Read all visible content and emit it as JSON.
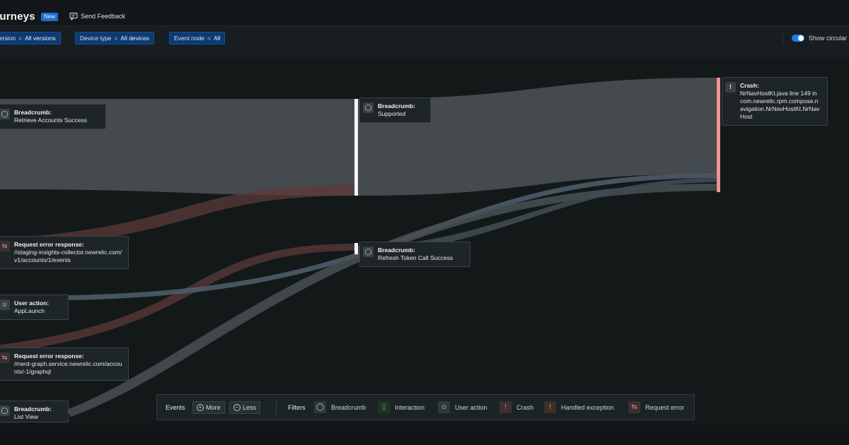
{
  "header": {
    "title": "ourneys",
    "badge": "New",
    "feedback_label": "Send Feedback"
  },
  "filters": [
    {
      "key": "ersion",
      "op": "=",
      "value": "All versions"
    },
    {
      "key": "Device type",
      "op": "=",
      "value": "All devices"
    },
    {
      "key": "Event node",
      "op": "=",
      "value": "All"
    }
  ],
  "toggle": {
    "label": "Show circular",
    "on": true
  },
  "nodes": {
    "n1": {
      "type": "Breadcrumb:",
      "label": "Retrieve Accounts Success",
      "icon": "breadcrumb-icon"
    },
    "n2": {
      "type": "Request error response:",
      "label": "//staging-insights-collector.newrelic.com/v1/accounts/1/events",
      "icon": "request-error-icon"
    },
    "n3": {
      "type": "User action:",
      "label": "AppLaunch",
      "icon": "user-action-icon"
    },
    "n4": {
      "type": "Request error response:",
      "label": "//nerd-graph.service.newrelic.com/accounts/-1/graphql",
      "icon": "request-error-icon"
    },
    "n5": {
      "type": "Breadcrumb:",
      "label": "List View",
      "icon": "breadcrumb-icon"
    },
    "n6": {
      "type": "Breadcrumb:",
      "label": "Supported",
      "icon": "breadcrumb-icon"
    },
    "n7": {
      "type": "Breadcrumb:",
      "label": "Refresh Token Call Success",
      "icon": "breadcrumb-icon"
    },
    "n8": {
      "type": "Crash:",
      "label": "NrNavHostKt.java line 149 in com.newrelic.rpm.compose.navigation.NrNavHostKt.NrNavHost",
      "icon": "crash-icon"
    }
  },
  "legend": {
    "events_label": "Events",
    "more_label": "More",
    "less_label": "Less",
    "filters_label": "Filters",
    "items": [
      {
        "label": "Breadcrumb",
        "icon": "breadcrumb-icon"
      },
      {
        "label": "Interaction",
        "icon": "interaction-icon"
      },
      {
        "label": "User action",
        "icon": "user-action-icon"
      },
      {
        "label": "Crash",
        "icon": "crash-icon"
      },
      {
        "label": "Handled exception",
        "icon": "handled-exception-icon"
      },
      {
        "label": "Request error",
        "icon": "request-error-icon"
      }
    ]
  },
  "colors": {
    "flow_gray": "#4a5053",
    "flow_red": "#6b3a38",
    "flow_blue": "#4a5a68",
    "crash_bar": "#f0938b",
    "accent": "#1c7cf0"
  }
}
